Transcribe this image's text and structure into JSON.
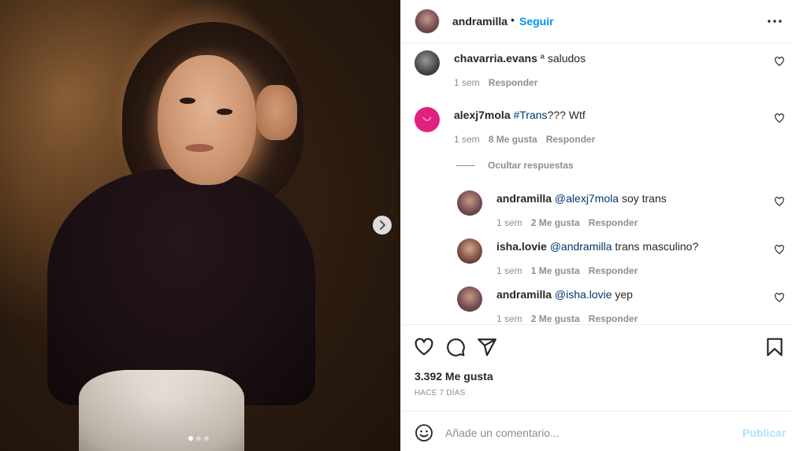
{
  "post": {
    "username": "andramilla",
    "separator": "•",
    "follow_label": "Seguir",
    "carousel": {
      "slide_count": 3,
      "active_index": 0
    }
  },
  "comments": [
    {
      "username": "chavarria.evans",
      "text": "ª saludos",
      "time": "1 sem",
      "likes": "",
      "reply": "Responder"
    },
    {
      "username": "alexj7mola",
      "hashtag": "#Trans",
      "text": "??? Wtf",
      "time": "1 sem",
      "likes": "8 Me gusta",
      "reply": "Responder"
    }
  ],
  "hide_replies": "Ocultar respuestas",
  "replies": [
    {
      "username": "andramilla",
      "mention": "@alexj7mola",
      "text": " soy trans",
      "time": "1 sem",
      "likes": "2 Me gusta",
      "reply": "Responder"
    },
    {
      "username": "isha.lovie",
      "mention": "@andramilla",
      "text": " trans masculino?",
      "time": "1 sem",
      "likes": "1 Me gusta",
      "reply": "Responder"
    },
    {
      "username": "andramilla",
      "mention": "@isha.lovie",
      "text": " yep",
      "time": "1 sem",
      "likes": "2 Me gusta",
      "reply": "Responder"
    }
  ],
  "footer": {
    "likes": "3.392 Me gusta",
    "date": "HACE 7 DÍAS",
    "comment_placeholder": "Añade un comentario...",
    "publish_label": "Publicar"
  },
  "colors": {
    "link_blue": "#0095f6",
    "publish_disabled": "#b2dffc",
    "mention": "#00376b",
    "muted": "#8e8e8e",
    "avatar_pink": "#e0217f"
  },
  "icons": [
    "more-options-icon",
    "heart-icon",
    "comment-icon",
    "share-icon",
    "bookmark-icon",
    "emoji-icon",
    "chevron-right-icon"
  ]
}
